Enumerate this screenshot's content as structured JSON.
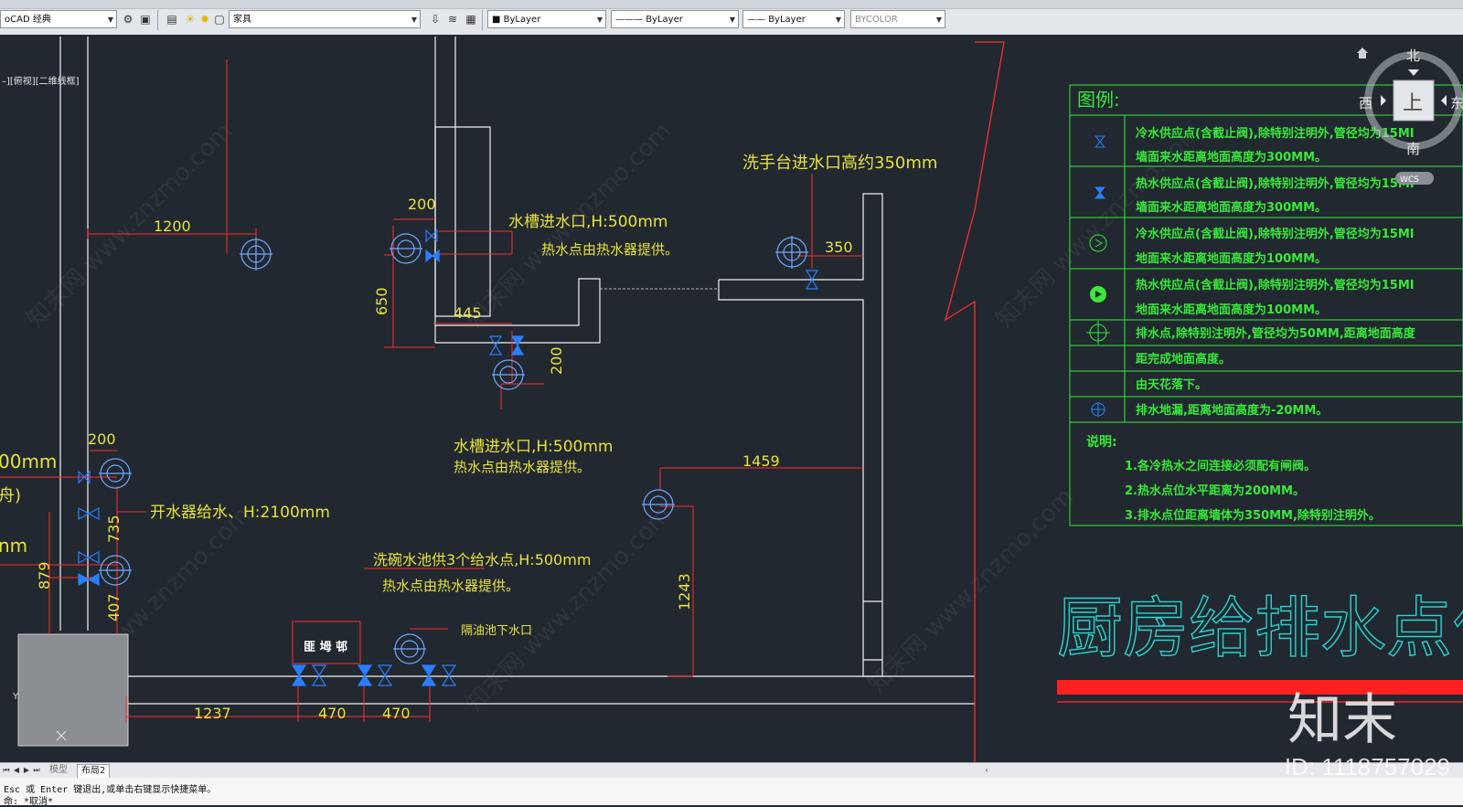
{
  "toolbar": {
    "workspace": "oCAD 经典",
    "layer": "家具",
    "color": "ByLayer",
    "linetype": "ByLayer",
    "lineweight": "ByLayer",
    "plotstyle": "BYCOLOR"
  },
  "viewport": {
    "label": "–][俯视][二维线框]"
  },
  "legend": {
    "title": "图例:",
    "rows": [
      {
        "icon": "cold-valve-small-icon",
        "text": "冷水供应点(含截止阀),除特别注明外,管径均为15MI"
      },
      {
        "icon": "",
        "text": "墙面来水距离地面高度为300MM。"
      },
      {
        "icon": "hot-valve-small-icon",
        "text": "热水供应点(含截止阀),除特别注明外,管径均为15MI"
      },
      {
        "icon": "",
        "text": "墙面来水距离地面高度为300MM。"
      },
      {
        "icon": "cold-floor-icon",
        "text": "冷水供应点(含截止阀),除特别注明外,管径均为15MI"
      },
      {
        "icon": "",
        "text": "地面来水距离地面高度为100MM。"
      },
      {
        "icon": "hot-floor-icon",
        "text": "热水供应点(含截止阀),除特别注明外,管径均为15MI"
      },
      {
        "icon": "",
        "text": "地面来水距离地面高度为100MM。"
      },
      {
        "icon": "drain-icon",
        "text": "排水点,除特别注明外,管径均为50MM,距离地面高度"
      },
      {
        "icon": "",
        "text": "距完成地面高度。"
      },
      {
        "icon": "",
        "text": "由天花落下。"
      },
      {
        "icon": "floor-drain-icon",
        "text": "排水地漏,距离地面高度为-20MM。"
      }
    ],
    "notes_title": "说明:",
    "notes": [
      "1.各冷热水之间连接必须配有闸阀。",
      "2.热水点位水平距离为200MM。",
      "3.排水点位距离墙体为350MM,除特别注明外。"
    ]
  },
  "drawing": {
    "title": "厨房给排水点位图",
    "annotations": {
      "basin": "洗手台进水口高约350mm",
      "sink1_a": "水槽进水口,H:500mm",
      "sink1_b": "热水点由热水器提供。",
      "sink2_a": "水槽进水口,H:500mm",
      "sink2_b": "热水点由热水器提供。",
      "boiler": "开水器给水、H:2100mm",
      "dish_a": "洗碗水池供3个给水点,H:500mm",
      "dish_b": "热水点由热水器提供。",
      "grease": "隔油池下水口",
      "left_top": "00mm",
      "left_mid": "舟)",
      "left_bot": "nm",
      "equip": "匪 坶 邨"
    },
    "dims": {
      "d1200": "1200",
      "d200a": "200",
      "d650": "650",
      "d445": "445",
      "d200b": "200",
      "d350": "350",
      "d1459": "1459",
      "d1243": "1243",
      "d200c": "200",
      "d735": "735",
      "d879": "879",
      "d407": "407",
      "d1237": "1237",
      "d470a": "470",
      "d470b": "470"
    }
  },
  "viewcube": {
    "north": "北",
    "south": "南",
    "west": "西",
    "east": "东",
    "top": "上",
    "wcs": "WCS"
  },
  "tabs": {
    "model": "模型",
    "layout": "布局2"
  },
  "cmd": {
    "line1": "Esc 或 Enter 键退出,或单击右键显示快捷菜单。",
    "line2": "命: *取消*"
  },
  "watermark": {
    "brand": "知末",
    "id": "ID: 1118757029",
    "site": "知末网 www.znzmo.com"
  },
  "colors": {
    "background": "#212830",
    "dimension": "#ff2d2d",
    "text_yellow": "#e8e23a",
    "legend_green": "#38e83a",
    "title_cyan": "#2ad3cf",
    "valve_blue": "#2a7fff"
  }
}
